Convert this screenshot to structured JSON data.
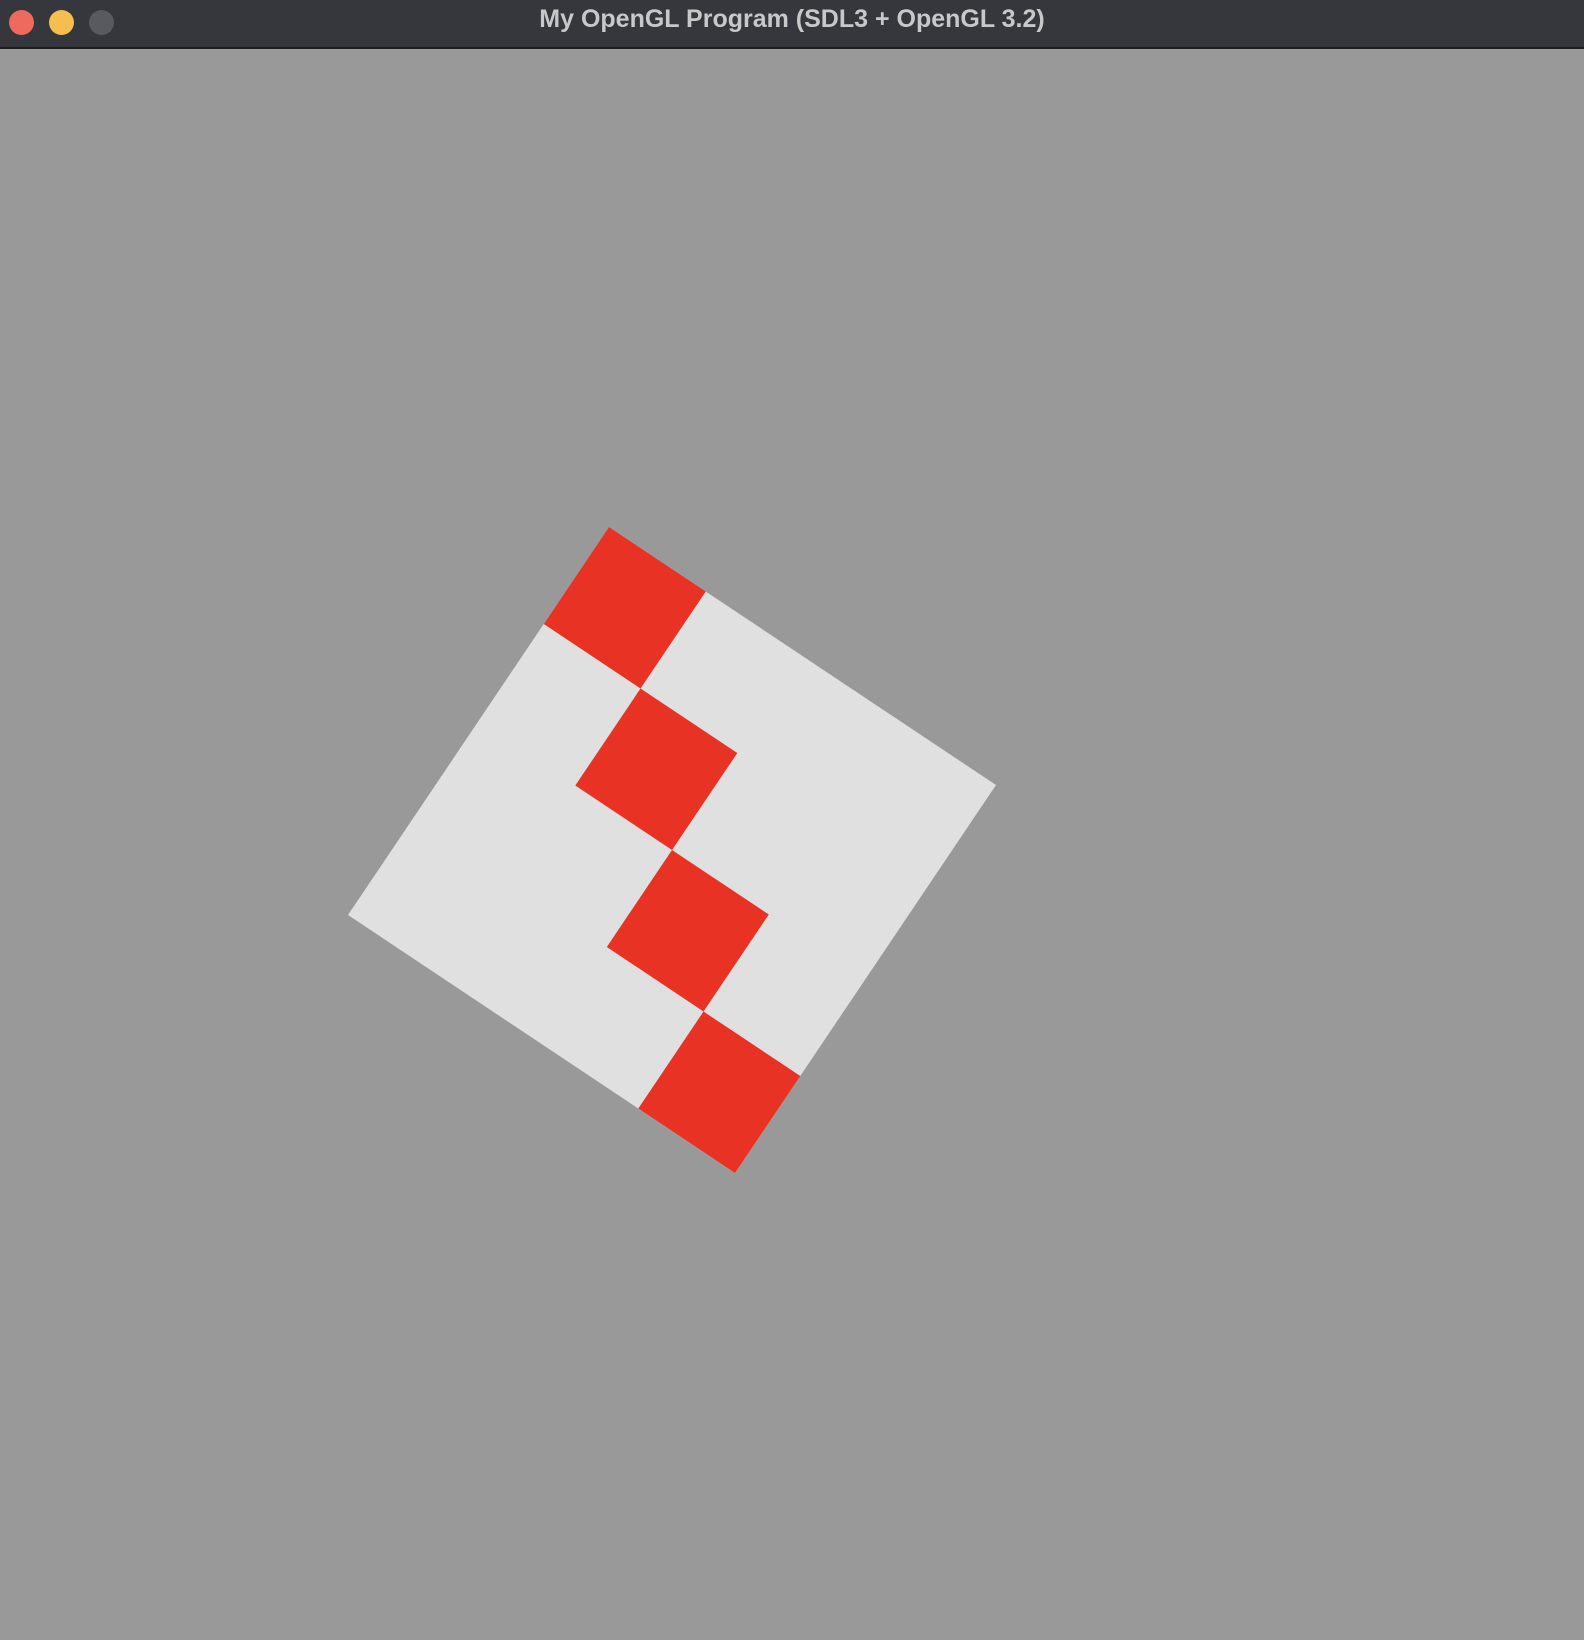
{
  "window": {
    "title": "My OpenGL Program (SDL3 + OpenGL 3.2)",
    "controls": {
      "close_color": "#ee6a5f",
      "minimize_color": "#f5be4f",
      "zoom_color": "#595a5f"
    }
  },
  "scene": {
    "clear_color": "#999999",
    "board": {
      "grid_size": 4,
      "base_color": "#e0e0e0",
      "accent_color": "#e83224",
      "highlighted_cells": [
        {
          "row": 0,
          "col": 0
        },
        {
          "row": 1,
          "col": 1
        },
        {
          "row": 2,
          "col": 2
        },
        {
          "row": 3,
          "col": 3
        }
      ]
    }
  }
}
